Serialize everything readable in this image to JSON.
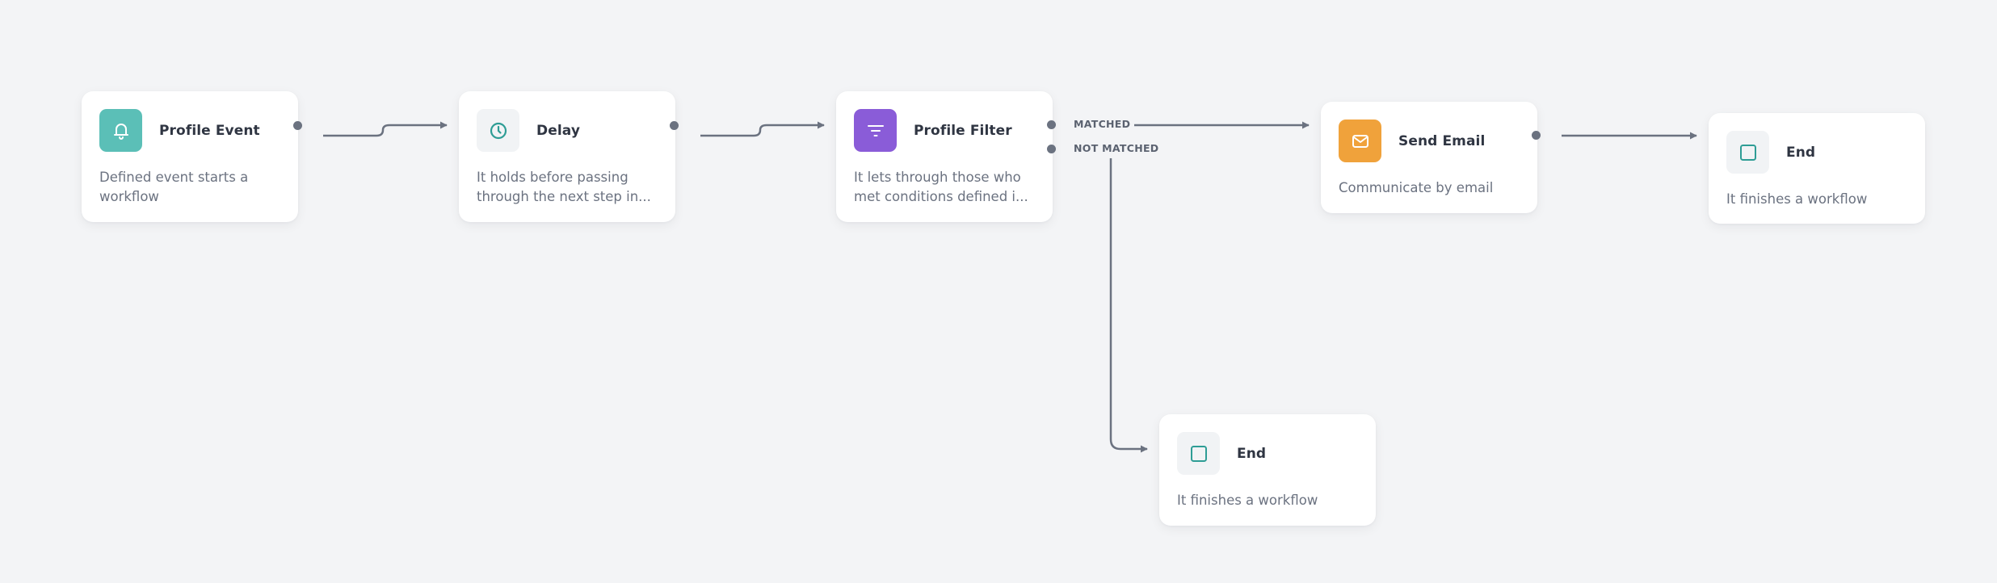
{
  "colors": {
    "background": "#f3f4f6",
    "edge": "#6b7280",
    "teal": "#5bbfb7",
    "teal_icon": "#2e9d95",
    "purple": "#8a5cd8",
    "orange": "#f0a23b",
    "neutral_icon_bg": "#f1f3f5"
  },
  "nodes": [
    {
      "id": "profile-event",
      "title": "Profile Event",
      "description": "Defined event starts a\nworkflow",
      "icon": "bell-icon"
    },
    {
      "id": "delay",
      "title": "Delay",
      "description": "It holds before passing\nthrough the next step in...",
      "icon": "clock-icon"
    },
    {
      "id": "profile-filter",
      "title": "Profile Filter",
      "description": "It lets through those who\nmet conditions defined i...",
      "icon": "filter-icon",
      "outputs": [
        "MATCHED",
        "NOT MATCHED"
      ]
    },
    {
      "id": "send-email",
      "title": "Send Email",
      "description": "Communicate by email",
      "icon": "mail-icon"
    },
    {
      "id": "end-matched",
      "title": "End",
      "description": "It finishes a workflow",
      "icon": "square-icon"
    },
    {
      "id": "end-not-matched",
      "title": "End",
      "description": "It finishes a workflow",
      "icon": "square-icon"
    }
  ],
  "edges": [
    {
      "from": "profile-event",
      "to": "delay"
    },
    {
      "from": "delay",
      "to": "profile-filter"
    },
    {
      "from": "profile-filter",
      "port": "MATCHED",
      "to": "send-email"
    },
    {
      "from": "profile-filter",
      "port": "NOT MATCHED",
      "to": "end-not-matched"
    },
    {
      "from": "send-email",
      "to": "end-matched"
    }
  ]
}
